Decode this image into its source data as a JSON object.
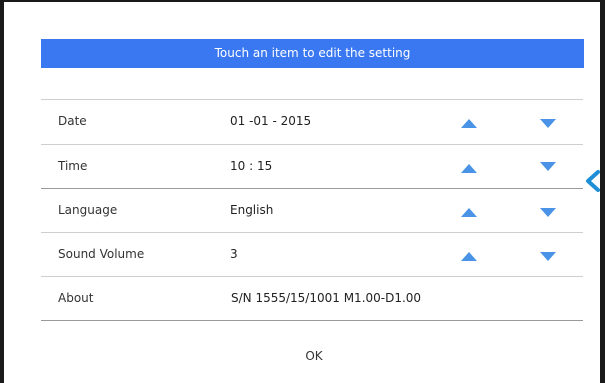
{
  "header": {
    "title": "Touch an item to edit the setting"
  },
  "settings": [
    {
      "label": "Date",
      "value": "01 -01 - 2015"
    },
    {
      "label": "Time",
      "value": "10 : 15"
    },
    {
      "label": "Language",
      "value": "English"
    },
    {
      "label": "Sound Volume",
      "value": "3"
    },
    {
      "label": "About",
      "value": "S/N 1555/15/1001 M1.00-D1.00"
    }
  ],
  "footer": {
    "ok_label": "OK"
  },
  "colors": {
    "banner": "#3a78f2",
    "arrow": "#4a93e6",
    "pointer": "#1e8fd6"
  },
  "icons": {
    "increment": "arrow-up-icon",
    "decrement": "arrow-down-icon",
    "pointer": "left-pointer-icon"
  }
}
